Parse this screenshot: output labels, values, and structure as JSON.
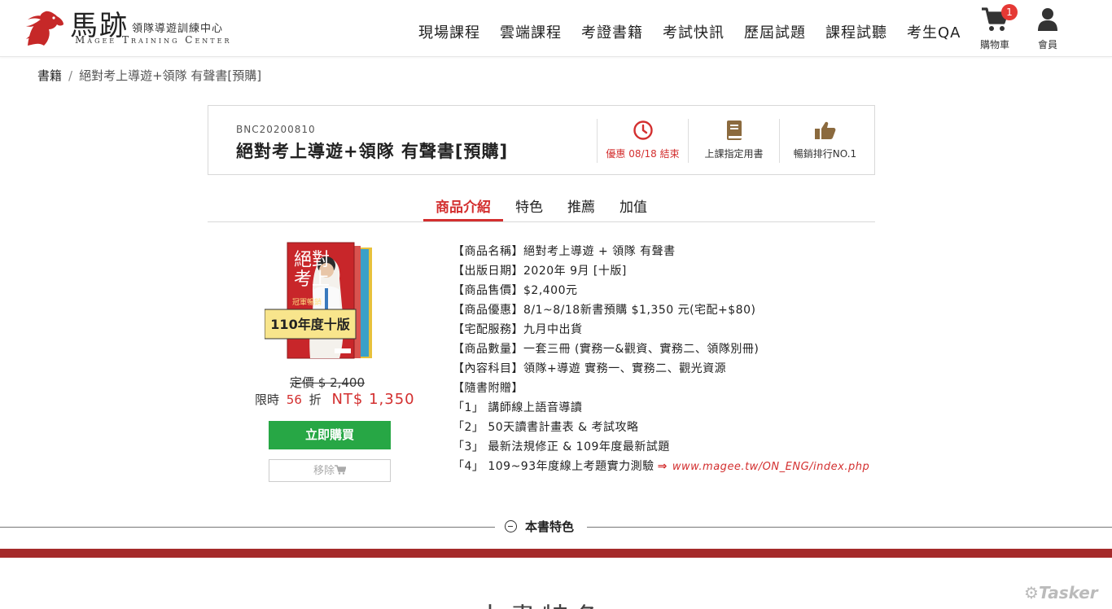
{
  "brand": {
    "name_cn": "馬跡",
    "subtitle_cn": "領隊導遊訓練中心",
    "name_en": "Magee Training Center",
    "accent_color": "#d32f2f"
  },
  "nav": {
    "items": [
      "現場課程",
      "雲端課程",
      "考證書籍",
      "考試快訊",
      "歷屆試題",
      "課程試聽",
      "考生QA"
    ],
    "cart_label": "購物車",
    "cart_count": "1",
    "member_label": "會員"
  },
  "breadcrumb": {
    "root": "書籍",
    "separator": "/",
    "current": "絕對考上導遊+領隊 有聲書[預購]"
  },
  "product": {
    "sku": "BNC20200810",
    "title": "絕對考上導遊+領隊 有聲書[預購]",
    "features": [
      {
        "icon": "clock-icon",
        "label": "優惠 08/18 結束"
      },
      {
        "icon": "book-icon",
        "label": "上課指定用書"
      },
      {
        "icon": "thumbs-up-icon",
        "label": "暢銷排行NO.1"
      }
    ],
    "cover": {
      "title_line1": "絕對",
      "title_line2": "考上",
      "sub": "冠軍暢銷",
      "edition_badge": "110年度十版"
    },
    "list_price": "定價 $ 2,400",
    "sale_prefix": "限時",
    "discount": "56",
    "sale_suffix": "折",
    "sale_price": "NT$ 1,350",
    "buy_label": "立即購買",
    "remove_label": "移除"
  },
  "tabs": [
    "商品介紹",
    "特色",
    "推薦",
    "加值"
  ],
  "info": {
    "rows": [
      "【商品名稱】絕對考上導遊 + 領隊 有聲書",
      "【出版日期】2020年 9月 [十版]",
      "【商品售價】$2,400元",
      "【商品優惠】8/1~8/18新書預購 $1,350 元(宅配+$80)",
      "【宅配服務】九月中出貨",
      "【商品數量】一套三冊 (實務一&觀資、實務二、領隊別冊)",
      "【內容科目】領隊+導遊 實務一、實務二、觀光資源",
      "【隨書附贈】",
      "「1」 講師線上語音導讀",
      "「2」 50天讀書計畫表 & 考試攻略",
      "「3」 最新法規修正 & 109年度最新試題"
    ],
    "last_row": "「4」 109~93年度線上考題實力測驗",
    "arrow": "⇒",
    "link": "www.magee.tw/ON_ENG/index.php"
  },
  "section": {
    "divider_label": "本書特色",
    "title": "本書特色"
  },
  "watermark": "Tasker"
}
